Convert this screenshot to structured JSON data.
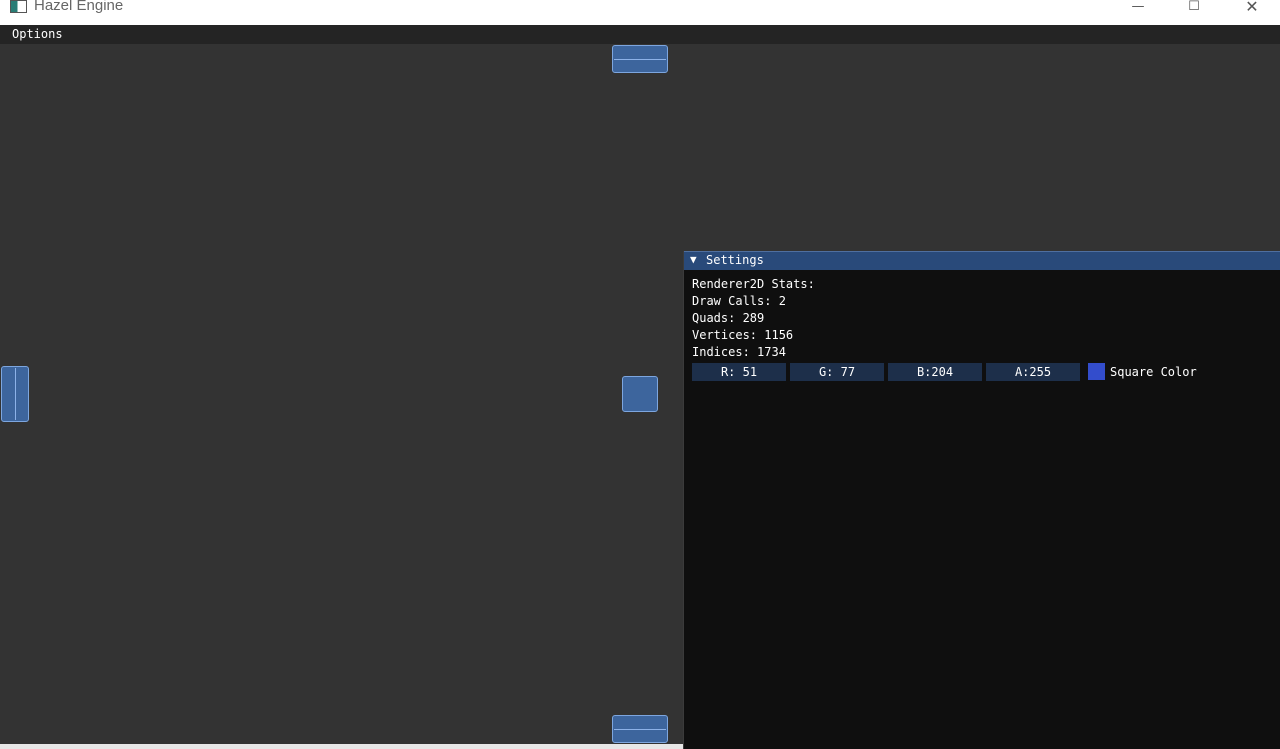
{
  "window": {
    "title": "Hazel Engine",
    "minimize_icon": "—",
    "maximize_icon": "☐",
    "close_icon": "✕"
  },
  "menu": {
    "options_label": "Options"
  },
  "settings": {
    "title": "Settings",
    "collapse_icon": "▼",
    "stats": {
      "heading": "Renderer2D Stats:",
      "draw_calls": "Draw Calls: 2",
      "quads": "Quads: 289",
      "vertices": "Vertices: 1156",
      "indices": "Indices: 1734"
    },
    "square_color": {
      "r": "R: 51",
      "g": "G: 77",
      "b": "B:204",
      "a": "A:255",
      "swatch_color": "#334dcc",
      "label": "Square Color"
    }
  },
  "colors": {
    "viewport_background": "#333333",
    "menu_background": "#242424",
    "settings_background": "#0f0f0f",
    "header_background": "#294a7a",
    "dock_button_fill": "#3d659d"
  }
}
